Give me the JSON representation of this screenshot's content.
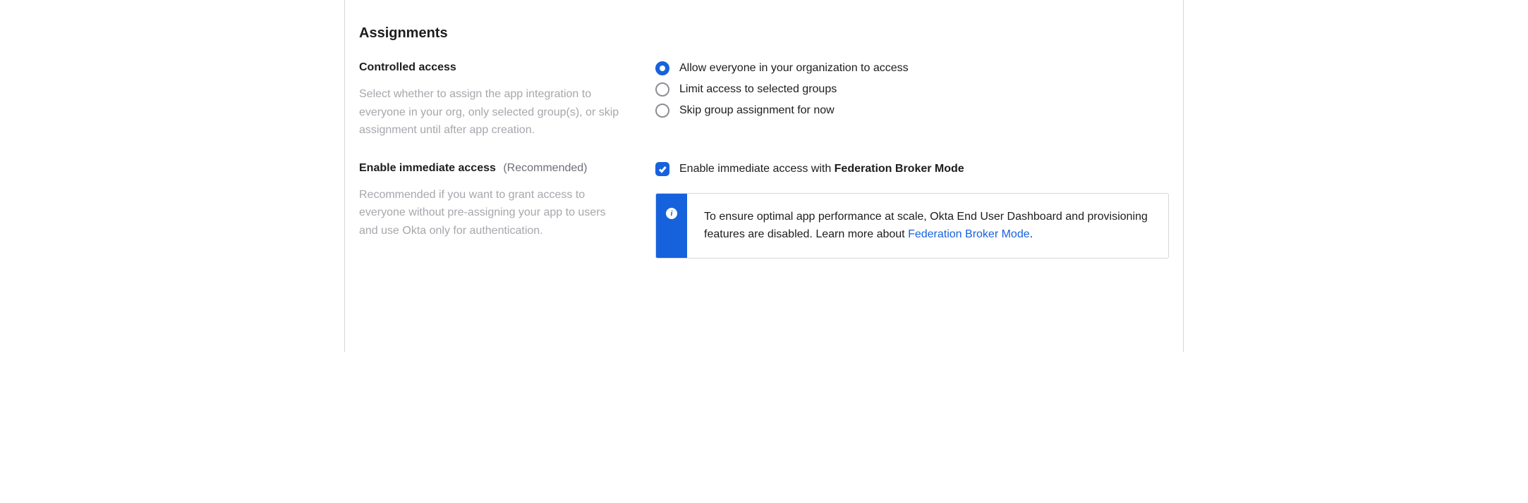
{
  "assignments": {
    "title": "Assignments",
    "controlled_access": {
      "label": "Controlled access",
      "description": "Select whether to assign the app integration to everyone in your org, only selected group(s), or skip assignment until after app creation.",
      "options": [
        {
          "label": "Allow everyone in your organization to access",
          "selected": true
        },
        {
          "label": "Limit access to selected groups",
          "selected": false
        },
        {
          "label": "Skip group assignment for now",
          "selected": false
        }
      ]
    },
    "immediate_access": {
      "label": "Enable immediate access",
      "hint": "(Recommended)",
      "description": "Recommended if you want to grant access to everyone without pre-assigning your app to users and use Okta only for authentication.",
      "checkbox_prefix": "Enable immediate access with ",
      "checkbox_strong": "Federation Broker Mode",
      "checked": true,
      "info_text": "To ensure optimal app performance at scale, Okta End User Dashboard and provisioning features are disabled. Learn more about ",
      "info_link_text": "Federation Broker Mode",
      "info_suffix": "."
    }
  }
}
